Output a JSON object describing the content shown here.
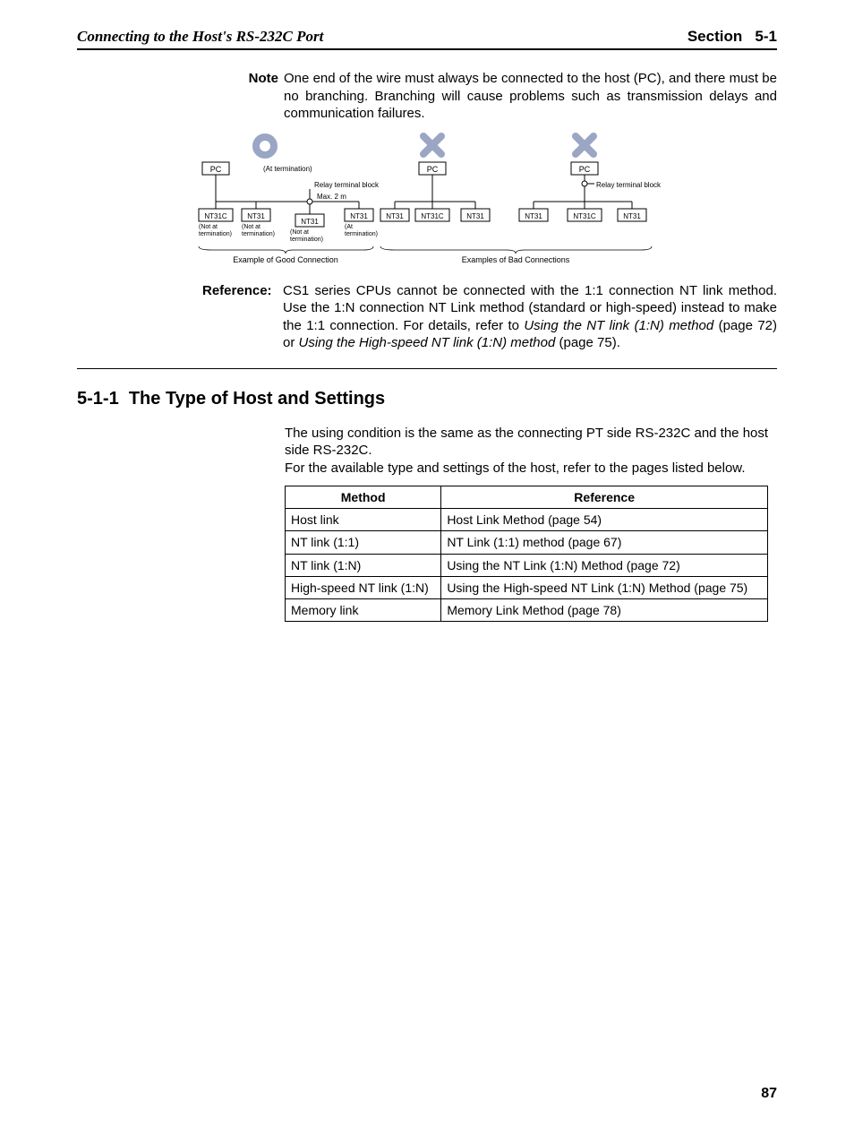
{
  "header": {
    "left": "Connecting to the Host's RS-232C Port",
    "section_word": "Section",
    "section_num": "5-1"
  },
  "note": {
    "label": "Note",
    "text": "One end of the wire must always be connected to the host (PC), and there must be no branching. Branching will cause problems such as transmission delays and communication failures."
  },
  "diagram": {
    "pc": "PC",
    "at_term": "(At termination)",
    "not_at_term": "(Not at termination)",
    "relay_block": "Relay terminal block",
    "max2m": "Max. 2 m",
    "nt31c": "NT31C",
    "nt31": "NT31",
    "good_caption": "Example of Good Connection",
    "bad_caption": "Examples of Bad Connections"
  },
  "reference": {
    "label": "Reference:",
    "text_1": "CS1 series CPUs cannot be connected with the 1:1 connection NT link method. Use the 1:N connection NT Link method (standard or high-speed) instead to make the 1:1 connection. For details, refer to ",
    "ital_1": "Using the NT link (1:N) method",
    "text_2": " (page 72) or ",
    "ital_2": "Using the High-speed NT link (1:N) method",
    "text_3": " (page 75)."
  },
  "subsection": {
    "number": "5-1-1",
    "title": "The Type of Host and Settings",
    "para1": "The using condition is the same as the connecting PT side RS-232C and the host side RS-232C.",
    "para2": "For the available type and settings of the host, refer to the pages listed below."
  },
  "table": {
    "headers": {
      "method": "Method",
      "reference": "Reference"
    },
    "rows": [
      {
        "method": "Host link",
        "reference": "Host Link Method (page 54)"
      },
      {
        "method": "NT link (1:1)",
        "reference": "NT Link (1:1) method (page 67)"
      },
      {
        "method": "NT link (1:N)",
        "reference": "Using the NT Link (1:N) Method (page 72)"
      },
      {
        "method": "High-speed NT link (1:N)",
        "reference": "Using the High-speed NT Link (1:N) Method (page 75)"
      },
      {
        "method": "Memory link",
        "reference": "Memory Link Method (page 78)"
      }
    ]
  },
  "page_number": "87"
}
